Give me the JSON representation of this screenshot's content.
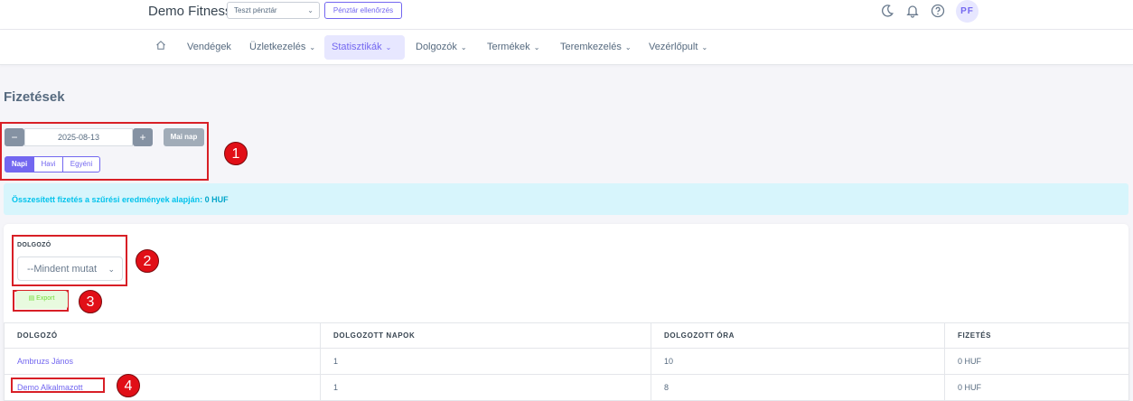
{
  "header": {
    "brand": "Demo Fitness",
    "register_select": "Teszt pénztár",
    "register_check_button": "Pénztár ellenőrzés",
    "user_initials": "PF",
    "icons": [
      "moon-icon",
      "bell-icon",
      "help-icon"
    ]
  },
  "nav": {
    "items": [
      {
        "label": "Vendégek",
        "has_dropdown": false
      },
      {
        "label": "Üzletkezelés",
        "has_dropdown": true
      },
      {
        "label": "Statisztikák",
        "has_dropdown": true,
        "active": true
      },
      {
        "label": "Dolgozók",
        "has_dropdown": true
      },
      {
        "label": "Termékek",
        "has_dropdown": true
      },
      {
        "label": "Teremkezelés",
        "has_dropdown": true
      },
      {
        "label": "Vezérlőpult",
        "has_dropdown": true
      }
    ]
  },
  "page": {
    "title": "Fizetések"
  },
  "date_filter": {
    "minus": "−",
    "plus": "+",
    "date": "2025-08-13",
    "today_button": "Mai nap",
    "period_tabs": [
      {
        "label": "Napi",
        "active": true
      },
      {
        "label": "Havi",
        "active": false
      },
      {
        "label": "Egyéni",
        "active": false
      }
    ]
  },
  "summary": {
    "text": "Összesített fizetés a szűrési eredmények alapján:",
    "amount": "0 HUF"
  },
  "employee_filter": {
    "label": "DOLGOZÓ",
    "selected": "--Mindent mutat"
  },
  "export_button": "Export",
  "table": {
    "columns": [
      "DOLGOZÓ",
      "DOLGOZOTT NAPOK",
      "DOLGOZOTT ÓRA",
      "FIZETÉS"
    ],
    "rows": [
      {
        "name": "Ambruzs János",
        "days": "1",
        "hours": "10",
        "pay": "0 HUF"
      },
      {
        "name": "Demo Alkalmazott",
        "days": "1",
        "hours": "8",
        "pay": "0 HUF"
      }
    ]
  },
  "annotations": [
    "1",
    "2",
    "3",
    "4"
  ],
  "colors": {
    "primary": "#7367f0",
    "info": "#03c3ec",
    "success": "#71dd37",
    "annotation": "#e10f17"
  }
}
